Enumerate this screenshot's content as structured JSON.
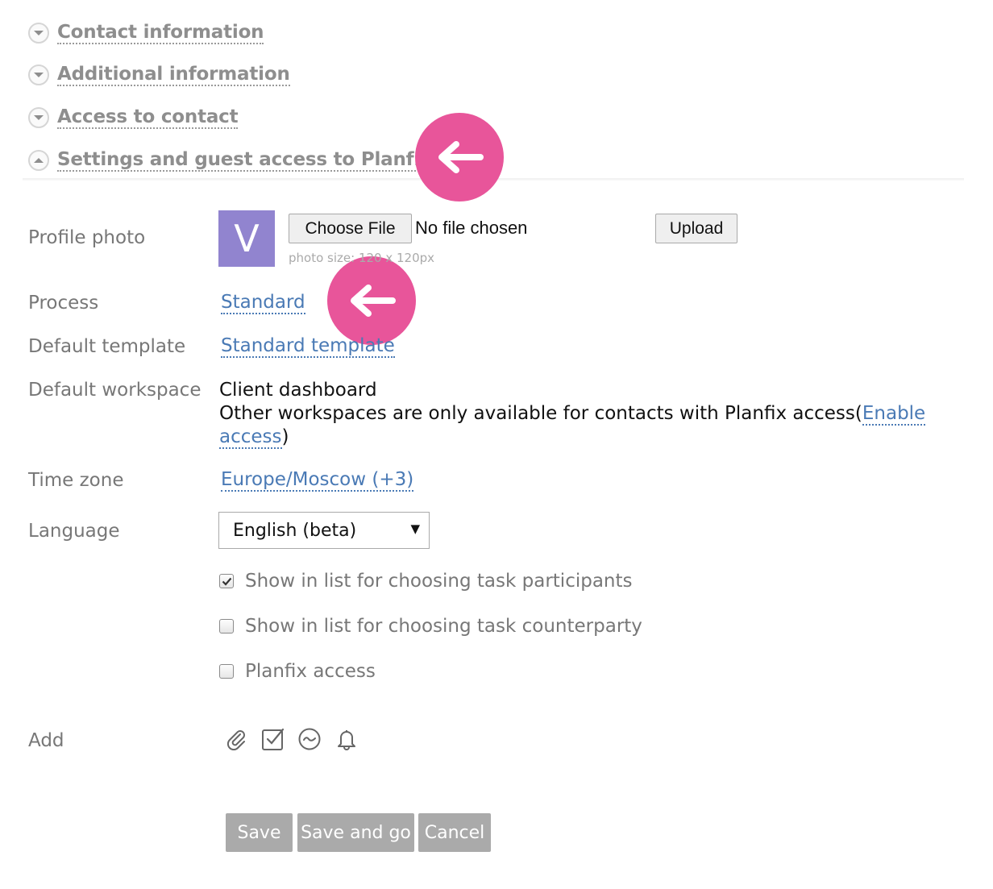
{
  "sections": [
    {
      "label": "Contact information",
      "state": "collapsed",
      "icon": "chevron-down-icon"
    },
    {
      "label": "Additional information",
      "state": "collapsed",
      "icon": "chevron-down-icon"
    },
    {
      "label": "Access to contact",
      "state": "collapsed",
      "icon": "chevron-down-icon"
    },
    {
      "label": "Settings and guest access to Planfix",
      "state": "expanded",
      "icon": "chevron-up-icon"
    }
  ],
  "markers": {
    "color": "#e8559a",
    "icon": "arrow-left-icon"
  },
  "profile_photo": {
    "label": "Profile photo",
    "avatar_letter": "V",
    "avatar_color": "#9184cf",
    "choose_file_label": "Choose File",
    "file_status": "No file chosen",
    "upload_label": "Upload",
    "hint": "photo size: 120 x 120px"
  },
  "process": {
    "label": "Process",
    "value": "Standard"
  },
  "default_template": {
    "label": "Default template",
    "value": "Standard template"
  },
  "default_workspace": {
    "label": "Default workspace",
    "value": "Client dashboard",
    "note_prefix": "Other workspaces are only available for contacts with Planfix access(",
    "link_part1": "Enable",
    "link_part2": "access",
    "note_suffix": ")"
  },
  "time_zone": {
    "label": "Time zone",
    "value": "Europe/Moscow (+3)"
  },
  "language": {
    "label": "Language",
    "selected": "English (beta)"
  },
  "checkboxes": [
    {
      "label": "Show in list for choosing task participants",
      "checked": true
    },
    {
      "label": "Show in list for choosing task counterparty",
      "checked": false
    },
    {
      "label": "Planfix access",
      "checked": false
    }
  ],
  "add": {
    "label": "Add",
    "icons": [
      "paperclip-icon",
      "checkbox-task-icon",
      "analytics-icon",
      "bell-icon"
    ]
  },
  "actions": {
    "save": "Save",
    "save_and_go": "Save and go",
    "cancel": "Cancel"
  },
  "colors": {
    "link": "#4a7ab5",
    "label": "#777777",
    "button_bg": "#aaaaaa",
    "accent": "#e8559a"
  }
}
